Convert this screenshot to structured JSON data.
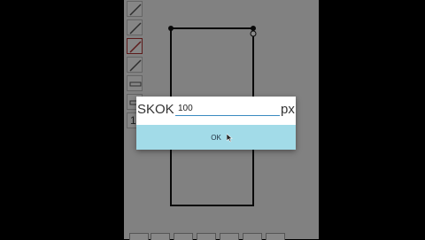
{
  "dialog": {
    "label": "SKOK",
    "value": "100",
    "unit": "px",
    "ok_label": "OK"
  },
  "toolbar": {
    "tools": [
      "line-tool-icon",
      "line-tool-icon",
      "line-tool-icon",
      "line-tool-icon",
      "ruler-icon",
      "ruler-icon",
      "number-icon"
    ],
    "number_fragment": "1"
  },
  "colors": {
    "dim_overlay": "#000000",
    "ok_button": "#a2dbe8",
    "input_underline": "#3a8bc0"
  }
}
